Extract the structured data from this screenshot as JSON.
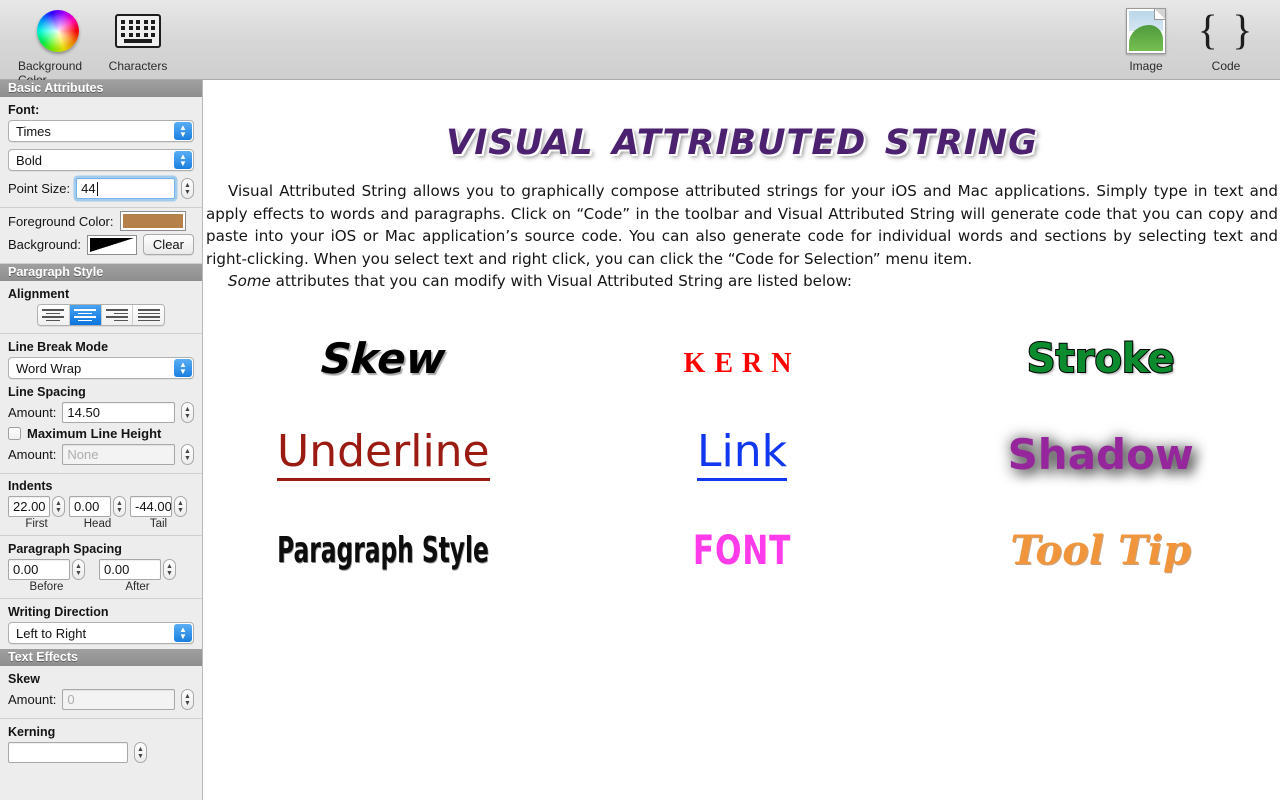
{
  "toolbar": {
    "left_items": [
      {
        "label": "Background Color",
        "icon": "color-wheel-icon"
      },
      {
        "label": "Characters",
        "icon": "keyboard-icon"
      }
    ],
    "right_items": [
      {
        "label": "Image",
        "icon": "image-icon"
      },
      {
        "label": "Code",
        "icon": "code-braces-icon"
      }
    ]
  },
  "sidebar": {
    "basic_attributes": {
      "header": "Basic Attributes",
      "font_label": "Font:",
      "font_family_value": "Times",
      "font_style_value": "Bold",
      "point_size_label": "Point Size:",
      "point_size_value": "44",
      "foreground_color_label": "Foreground Color:",
      "foreground_color_value": "#b5804a",
      "background_label": "Background:",
      "clear_button": "Clear"
    },
    "paragraph_style": {
      "header": "Paragraph Style",
      "alignment_label": "Alignment",
      "alignment_options": [
        "left",
        "center",
        "right",
        "justify"
      ],
      "alignment_selected": "center",
      "line_break_mode_label": "Line Break Mode",
      "line_break_mode_value": "Word Wrap",
      "line_spacing_label": "Line Spacing",
      "line_spacing_amount_label": "Amount:",
      "line_spacing_amount_value": "14.50",
      "maximum_line_height_label": "Maximum Line Height",
      "maximum_line_height_checked": false,
      "maximum_line_height_amount_label": "Amount:",
      "maximum_line_height_amount_placeholder": "None",
      "indents_label": "Indents",
      "indents": [
        {
          "value": "22.00",
          "caption": "First"
        },
        {
          "value": "0.00",
          "caption": "Head"
        },
        {
          "value": "-44.00",
          "caption": "Tail"
        }
      ],
      "paragraph_spacing_label": "Paragraph Spacing",
      "paragraph_spacing": [
        {
          "value": "0.00",
          "caption": "Before"
        },
        {
          "value": "0.00",
          "caption": "After"
        }
      ],
      "writing_direction_label": "Writing Direction",
      "writing_direction_value": "Left to Right"
    },
    "text_effects": {
      "header": "Text Effects",
      "skew_label": "Skew",
      "skew_amount_label": "Amount:",
      "skew_amount_placeholder": "0",
      "kerning_label": "Kerning"
    }
  },
  "document": {
    "title": "Visual Attributed String",
    "paragraph_1": "Visual Attributed String allows you to graphically compose attributed strings for your iOS and Mac applications. Simply type in text and apply effects to words and paragraphs.  Click on “Code” in the toolbar and Visual Attributed String will generate code that you can copy and paste into your iOS or Mac application’s source code. You can also generate code for individual words and sections by selecting text and right-clicking. When you select text and right click, you can click the “Code for Selection” menu item.",
    "paragraph_2_emphasis": "Some",
    "paragraph_2_rest": " attributes that you can modify with Visual Attributed String are listed below:",
    "samples": [
      {
        "text": "Skew",
        "style": "skew",
        "color": "#000000"
      },
      {
        "text": "Kern",
        "style": "kern",
        "color": "#ff0000"
      },
      {
        "text": "Stroke",
        "style": "stroke",
        "color": "#0b8a2e"
      },
      {
        "text": "Underline",
        "style": "underline",
        "color": "#9b1b13"
      },
      {
        "text": "Link",
        "style": "link",
        "color": "#1137f0"
      },
      {
        "text": "Shadow",
        "style": "shadow",
        "color": "#96269b"
      },
      {
        "text": "Paragraph Style",
        "style": "paragraph-style",
        "color": "#0d0d0d"
      },
      {
        "text": "FONT",
        "style": "font",
        "color": "#ff3bea"
      },
      {
        "text": "Tool Tip",
        "style": "tooltip",
        "color": "#f0953c"
      }
    ]
  }
}
